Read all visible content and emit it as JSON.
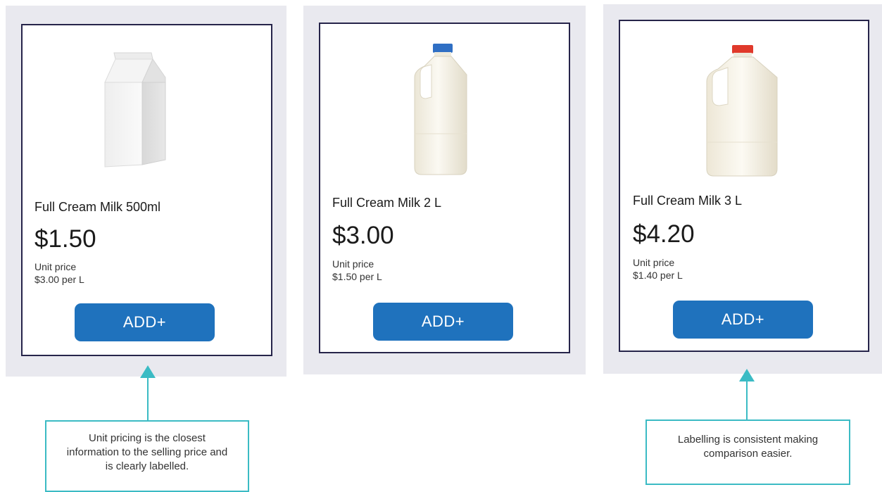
{
  "products": [
    {
      "name": "Full Cream Milk 500ml",
      "price": "$1.50",
      "unit_label": "Unit price",
      "unit_value": "$3.00 per L",
      "button_label": "ADD+",
      "image_icon": "milk-carton-icon"
    },
    {
      "name": "Full Cream Milk 2 L",
      "price": "$3.00",
      "unit_label": "Unit price",
      "unit_value": "$1.50 per L",
      "button_label": "ADD+",
      "image_icon": "milk-jug-blue-cap-icon"
    },
    {
      "name": "Full Cream Milk 3 L",
      "price": "$4.20",
      "unit_label": "Unit price",
      "unit_value": "$1.40 per L",
      "button_label": "ADD+",
      "image_icon": "milk-jug-red-cap-icon"
    }
  ],
  "callouts": [
    {
      "text": "Unit pricing is the closest information to the selling price and is clearly labelled."
    },
    {
      "text": "Labelling is consistent making comparison easier."
    }
  ],
  "colors": {
    "panel_bg": "#e9e9ef",
    "card_border": "#26244a",
    "button_bg": "#1f72bd",
    "button_text": "#ffffff",
    "callout_accent": "#3bbbc4",
    "cap_blue": "#2f6fc4",
    "cap_red": "#e0392b"
  }
}
